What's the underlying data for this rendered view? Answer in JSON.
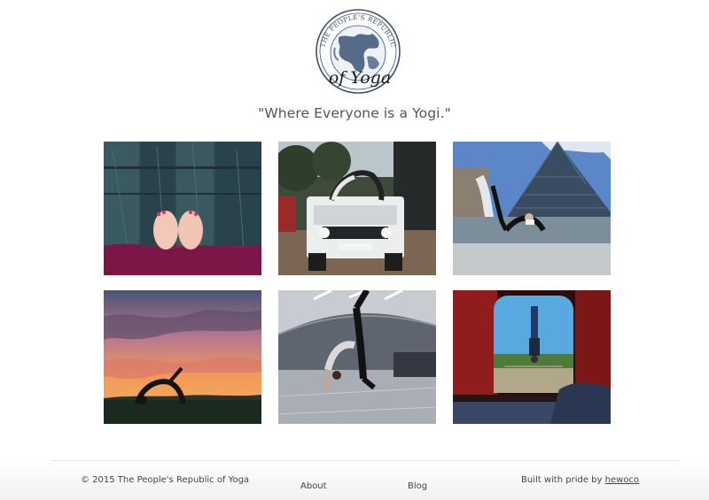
{
  "header": {
    "logo": {
      "arc_text": "THE PEOPLE'S REPUBLIC",
      "script_text": "of Yoga",
      "icon": "globe-seal-icon"
    },
    "tagline": "\"Where Everyone is a Yogi.\""
  },
  "gallery": {
    "images": [
      {
        "name": "feet-on-wooden-deck-photo"
      },
      {
        "name": "pose-on-white-land-rover-photo"
      },
      {
        "name": "backbend-at-louvre-pyramid-photo"
      },
      {
        "name": "backbend-at-sunset-photo"
      },
      {
        "name": "handstand-at-airport-photo"
      },
      {
        "name": "handstand-through-car-window-photo"
      }
    ]
  },
  "footer": {
    "copyright": "© 2015 The People's Republic of Yoga",
    "links": [
      "About",
      "Blog"
    ],
    "credit_prefix": "Built with pride by ",
    "credit_link": "hewoco"
  },
  "colors": {
    "text": "#444444",
    "footer_gradient_bottom": "#f1f1f1"
  }
}
